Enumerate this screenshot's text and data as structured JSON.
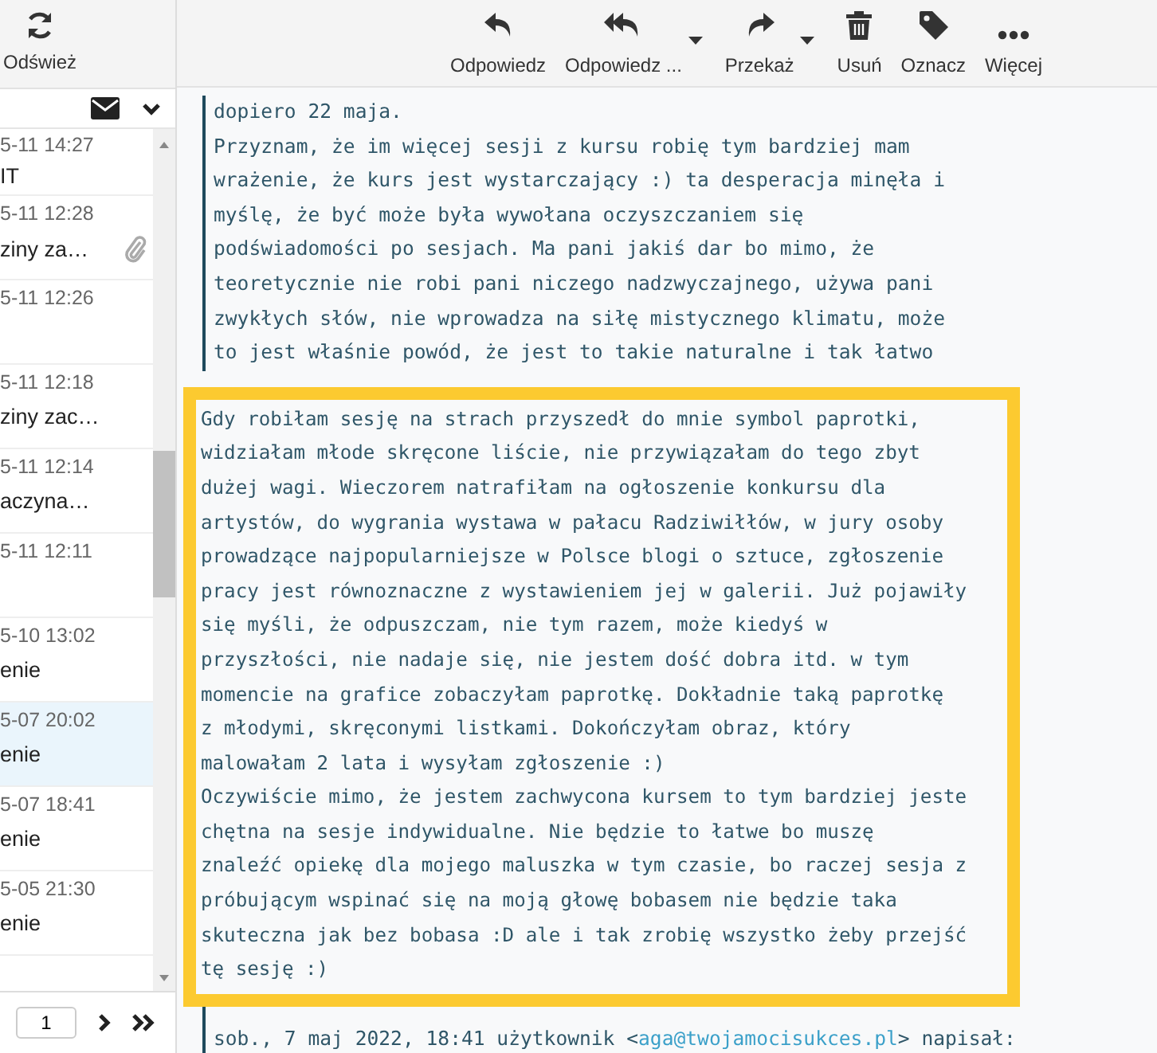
{
  "toolbar": {
    "refresh": {
      "label": "Odśwież"
    },
    "actions": [
      {
        "kind": "reply",
        "label": "Odpowiedz",
        "has_menu": false
      },
      {
        "kind": "reply_all",
        "label": "Odpowiedz ...",
        "has_menu": true
      },
      {
        "kind": "forward",
        "label": "Przekaż",
        "has_menu": true
      },
      {
        "kind": "delete",
        "label": "Usuń",
        "has_menu": false
      },
      {
        "kind": "tag",
        "label": "Oznacz",
        "has_menu": false
      },
      {
        "kind": "more",
        "label": "Więcej",
        "has_menu": false
      }
    ]
  },
  "message_list": {
    "rows": [
      {
        "date": "5-11 14:27",
        "subject": "IT",
        "attachment": false,
        "selected": false
      },
      {
        "date": "5-11 12:28",
        "subject": "ziny za…",
        "attachment": true,
        "selected": false
      },
      {
        "date": "5-11 12:26",
        "attachment": false,
        "selected": false
      },
      {
        "date": "5-11 12:18",
        "subject": "ziny zac…",
        "attachment": false,
        "selected": false
      },
      {
        "date": "5-11 12:14",
        "subject": "aczyna…",
        "attachment": false,
        "selected": false
      },
      {
        "date": "5-11 12:11",
        "attachment": false,
        "selected": false
      },
      {
        "date": "5-10 13:02",
        "subject": "enie",
        "attachment": false,
        "selected": false
      },
      {
        "date": "5-07 20:02",
        "subject": "enie",
        "attachment": false,
        "selected": true
      },
      {
        "date": "5-07 18:41",
        "subject": "enie",
        "attachment": false,
        "selected": false
      },
      {
        "date": "5-05 21:30",
        "subject": "enie",
        "attachment": false,
        "selected": false
      }
    ],
    "pager": {
      "page": "1"
    }
  },
  "message": {
    "quote_lines": [
      "dopiero 22 maja.",
      "Przyznam, że im więcej sesji z kursu robię tym bardziej mam",
      "wrażenie, że kurs jest wystarczający :) ta desperacja minęła i",
      "myślę, że być może była wywołana oczyszczaniem się",
      "podświadomości po sesjach. Ma pani jakiś dar bo mimo, że",
      "teoretycznie nie robi pani niczego nadzwyczajnego, używa pani",
      "zwykłych słów, nie wprowadza na siłę mistycznego klimatu, może",
      "to jest właśnie powód, że jest to takie naturalne i tak łatwo"
    ],
    "highlighted_lines": [
      "Gdy robiłam sesję na strach przyszedł do mnie symbol paprotki,",
      "widziałam młode skręcone liście, nie przywiązałam do tego zbyt",
      "dużej wagi. Wieczorem natrafiłam na ogłoszenie konkursu dla",
      "artystów, do wygrania wystawa w pałacu Radziwiłłów, w jury osoby",
      "prowadzące najpopularniejsze w Polsce blogi o sztuce, zgłoszenie",
      "pracy jest równoznaczne z wystawieniem jej w galerii. Już pojawiły",
      "się myśli, że odpuszczam, nie tym razem, może kiedyś w",
      "przyszłości, nie nadaje się, nie jestem dość dobra itd. w tym",
      "momencie na grafice zobaczyłam paprotkę. Dokładnie taką paprotkę",
      "z młodymi, skręconymi listkami. Dokończyłam obraz, który",
      "malowałam 2 lata i wysyłam zgłoszenie :)",
      "Oczywiście mimo, że jestem zachwycona kursem to tym bardziej jeste",
      "chętna na sesje indywidualne. Nie będzie to łatwe bo muszę",
      "znaleźć opiekę dla mojego maluszka w tym czasie, bo raczej sesja z",
      "próbującym wspinać się na moją głowę bobasem nie będzie taka",
      "skuteczna jak bez bobasa :D ale i tak zrobię wszystko żeby przejść",
      "tę sesję :)"
    ],
    "attribution": {
      "before": "sob., 7 maj 2022, 18:41 użytkownik <",
      "email": "aga@twojamocisukces.pl",
      "after": "> napisał:"
    }
  }
}
